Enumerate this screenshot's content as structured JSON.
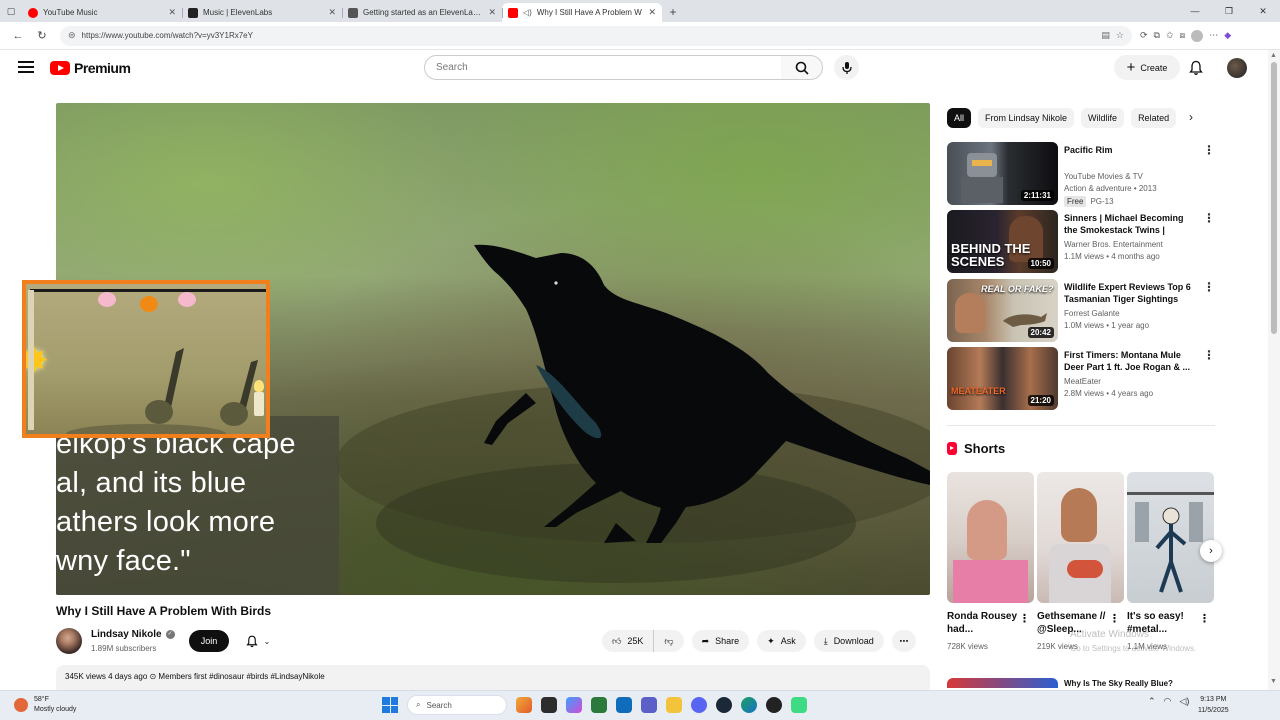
{
  "browser": {
    "tabs": [
      {
        "title": "YouTube Music",
        "favicon_color": "#ff0000",
        "active": false
      },
      {
        "title": "Music | ElevenLabs",
        "favicon_color": "#222222",
        "active": false
      },
      {
        "title": "Getting started as an ElevenLabs A",
        "favicon_color": "#555555",
        "active": false
      },
      {
        "title": "Why I Still Have A Problem W",
        "favicon_color": "#ff0000",
        "active": true
      }
    ],
    "url": "https://www.youtube.com/watch?v=yv3Y1Rx7eY"
  },
  "header": {
    "brand": "Premium",
    "search_placeholder": "Search",
    "create_label": "Create"
  },
  "player": {
    "caption_lines": [
      "elkop's black cape",
      "al, and its blue",
      "athers look more",
      "wny face.\""
    ]
  },
  "video": {
    "title": "Why I Still Have A Problem With Birds",
    "channel": "Lindsay Nikole",
    "subscribers": "1.89M subscribers",
    "join_label": "Join",
    "likes": "25K",
    "share_label": "Share",
    "ask_label": "Ask",
    "download_label": "Download",
    "description_line": "345K views  4 days ago  ⊙ Members first  #dinosaur #birds #LindsayNikole"
  },
  "chips": [
    "All",
    "From Lindsay Nikole",
    "Wildlife",
    "Related"
  ],
  "recommendations": [
    {
      "title": "Pacific Rim",
      "line1": "YouTube Movies & TV",
      "line2": "Action & adventure • 2013",
      "badge": "Free",
      "rating": "PG-13",
      "duration": "2:11:31"
    },
    {
      "title": "Sinners | Michael Becoming the Smokestack Twins | Behind the...",
      "line1": "Warner Bros. Entertainment",
      "line2": "1.1M views • 4 months ago",
      "duration": "10:50",
      "overlay": "BEHIND THE SCENES"
    },
    {
      "title": "Wildlife Expert Reviews Top 6 Tasmanian Tiger Sightings",
      "line1": "Forrest Galante",
      "line2": "1.0M views • 1 year ago",
      "duration": "20:42",
      "overlay": "REAL OR FAKE?"
    },
    {
      "title": "First Timers: Montana Mule Deer Part 1 ft. Joe Rogan & ...",
      "line1": "MeatEater",
      "line2": "2.8M views • 4 years ago",
      "duration": "21:20",
      "overlay": "MEATEATER"
    }
  ],
  "shorts": {
    "heading": "Shorts",
    "items": [
      {
        "title": "Ronda Rousey had...",
        "views": "728K views"
      },
      {
        "title": "Gethsemane // @Sleep...",
        "views": "219K views"
      },
      {
        "title": "It's so easy! #metal...",
        "views": "1.1M views"
      }
    ],
    "next_title": "Why Is The Sky Really Blue?"
  },
  "watermark": {
    "line1": "Activate Windows",
    "line2": "Go to Settings to activate Windows."
  },
  "taskbar": {
    "temperature": "58°F",
    "condition": "Mostly cloudy",
    "search_label": "Search",
    "time": "9:13 PM",
    "date": "11/5/2025"
  }
}
